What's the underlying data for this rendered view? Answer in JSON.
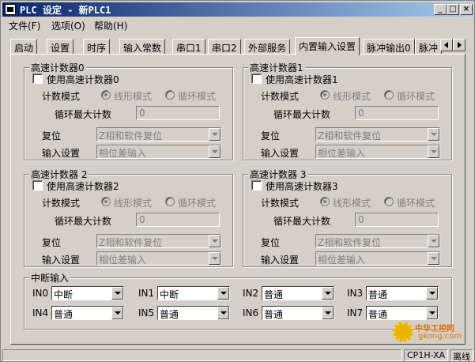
{
  "window": {
    "title": "PLC 设定 - 新PLC1"
  },
  "title_buttons": {
    "minimize": "_",
    "maximize": "□",
    "close": "×"
  },
  "menu": [
    {
      "label": "文件(F)"
    },
    {
      "label": "选项(O)"
    },
    {
      "label": "帮助(H)"
    }
  ],
  "tabs": [
    {
      "label": "启动"
    },
    {
      "label": "设置"
    },
    {
      "label": "时序"
    },
    {
      "label": "输入常数"
    },
    {
      "label": "串口1"
    },
    {
      "label": "串口2"
    },
    {
      "label": "外部服务"
    },
    {
      "label": "内置输入设置",
      "active": true
    },
    {
      "label": "脉冲输出0"
    },
    {
      "label": "脉冲"
    }
  ],
  "counter_labels": {
    "count_mode": "计数模式",
    "linear_mode": "线形模式",
    "ring_mode": "循环模式",
    "ring_max": "循环最大计数",
    "reset": "复位",
    "input_setting": "输入设置"
  },
  "counters": [
    {
      "title": "高速计数器0",
      "enable_label": "使用高速计数器0",
      "enabled": false,
      "mode": "linear",
      "ring_max": "0",
      "reset": "Z相和软件复位",
      "input_setting": "相位差输入"
    },
    {
      "title": "高速计数器1",
      "enable_label": "使用高速计数器1",
      "enabled": false,
      "mode": "linear",
      "ring_max": "0",
      "reset": "Z相和软件复位",
      "input_setting": "相位差输入"
    },
    {
      "title": "高速计数器 2",
      "enable_label": "使用高速计数器2",
      "enabled": false,
      "mode": "linear",
      "ring_max": "0",
      "reset": "Z相和软件复位",
      "input_setting": "相位差输入"
    },
    {
      "title": "高速计数器 3",
      "enable_label": "使用高速计数器3",
      "enabled": false,
      "mode": "linear",
      "ring_max": "0",
      "reset": "Z相和软件复位",
      "input_setting": "相位差输入"
    }
  ],
  "interrupt": {
    "title": "中断输入",
    "inputs": [
      {
        "label": "IN0",
        "value": "中断"
      },
      {
        "label": "IN1",
        "value": "中断"
      },
      {
        "label": "IN2",
        "value": "普通"
      },
      {
        "label": "IN3",
        "value": "普通"
      },
      {
        "label": "IN4",
        "value": "普通"
      },
      {
        "label": "IN5",
        "value": "普通"
      },
      {
        "label": "IN6",
        "value": "普通"
      },
      {
        "label": "IN7",
        "value": "普通"
      }
    ]
  },
  "status": {
    "model": "CP1H-XA",
    "connection": "离线"
  },
  "watermark": {
    "line1": "中华工控网",
    "line2": "gkong.com"
  },
  "colors": {
    "titlebar_start": "#0a246a",
    "titlebar_end": "#a6caf0",
    "face": "#d4d0c8",
    "disabled_text": "#808080"
  }
}
